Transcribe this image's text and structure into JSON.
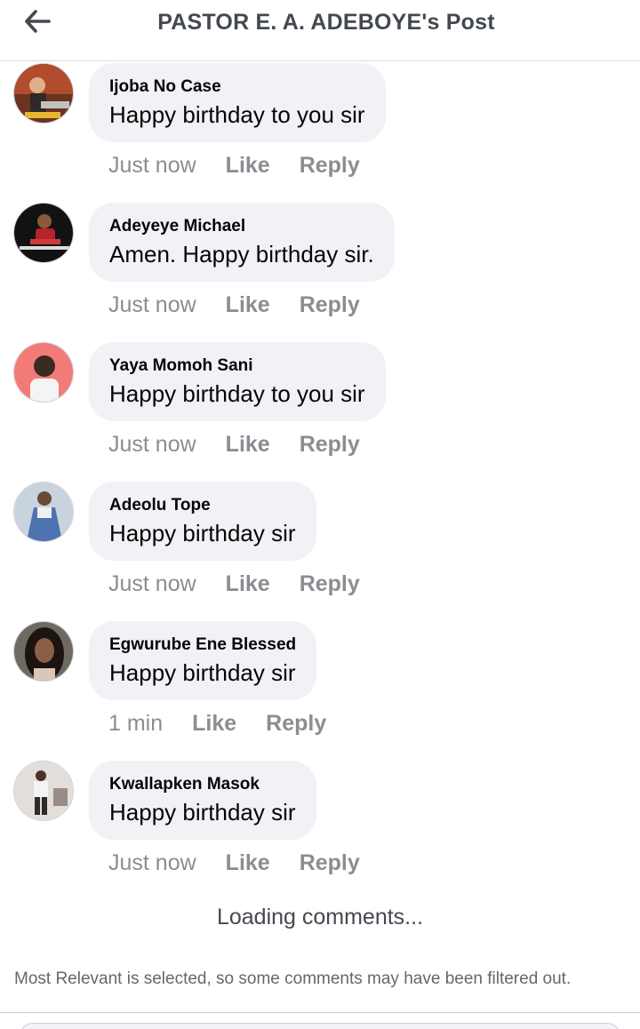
{
  "header": {
    "title": "PASTOR E. A. ADEBOYE's Post",
    "back_icon": "back-arrow-icon"
  },
  "comments": [
    {
      "author": "Ijoba No Case",
      "text": "Happy birthday to you sir",
      "time": "Just now",
      "like": "Like",
      "reply": "Reply",
      "avatar_colors": [
        "#7a3b1e",
        "#c9553a"
      ]
    },
    {
      "author": "Adeyeye Michael",
      "text": "Amen. Happy birthday sir.",
      "time": "Just now",
      "like": "Like",
      "reply": "Reply",
      "avatar_colors": [
        "#151515",
        "#b8222b"
      ]
    },
    {
      "author": "Yaya Momoh Sani",
      "text": "Happy birthday to you sir",
      "time": "Just now",
      "like": "Like",
      "reply": "Reply",
      "avatar_colors": [
        "#f06c6c",
        "#3b2a22"
      ]
    },
    {
      "author": "Adeolu Tope",
      "text": "Happy birthday sir",
      "time": "Just now",
      "like": "Like",
      "reply": "Reply",
      "avatar_colors": [
        "#8fa6c2",
        "#3d5a88"
      ]
    },
    {
      "author": "Egwurube Ene Blessed",
      "text": "Happy birthday sir",
      "time": "1 min",
      "like": "Like",
      "reply": "Reply",
      "avatar_colors": [
        "#5a4a3e",
        "#1c1410"
      ]
    },
    {
      "author": "Kwallapken Masok",
      "text": "Happy birthday sir",
      "time": "Just now",
      "like": "Like",
      "reply": "Reply",
      "avatar_colors": [
        "#d9d4cf",
        "#7d6e66"
      ]
    }
  ],
  "footer": {
    "loading": "Loading comments...",
    "notice": "Most Relevant is selected, so some comments may have been filtered out."
  }
}
